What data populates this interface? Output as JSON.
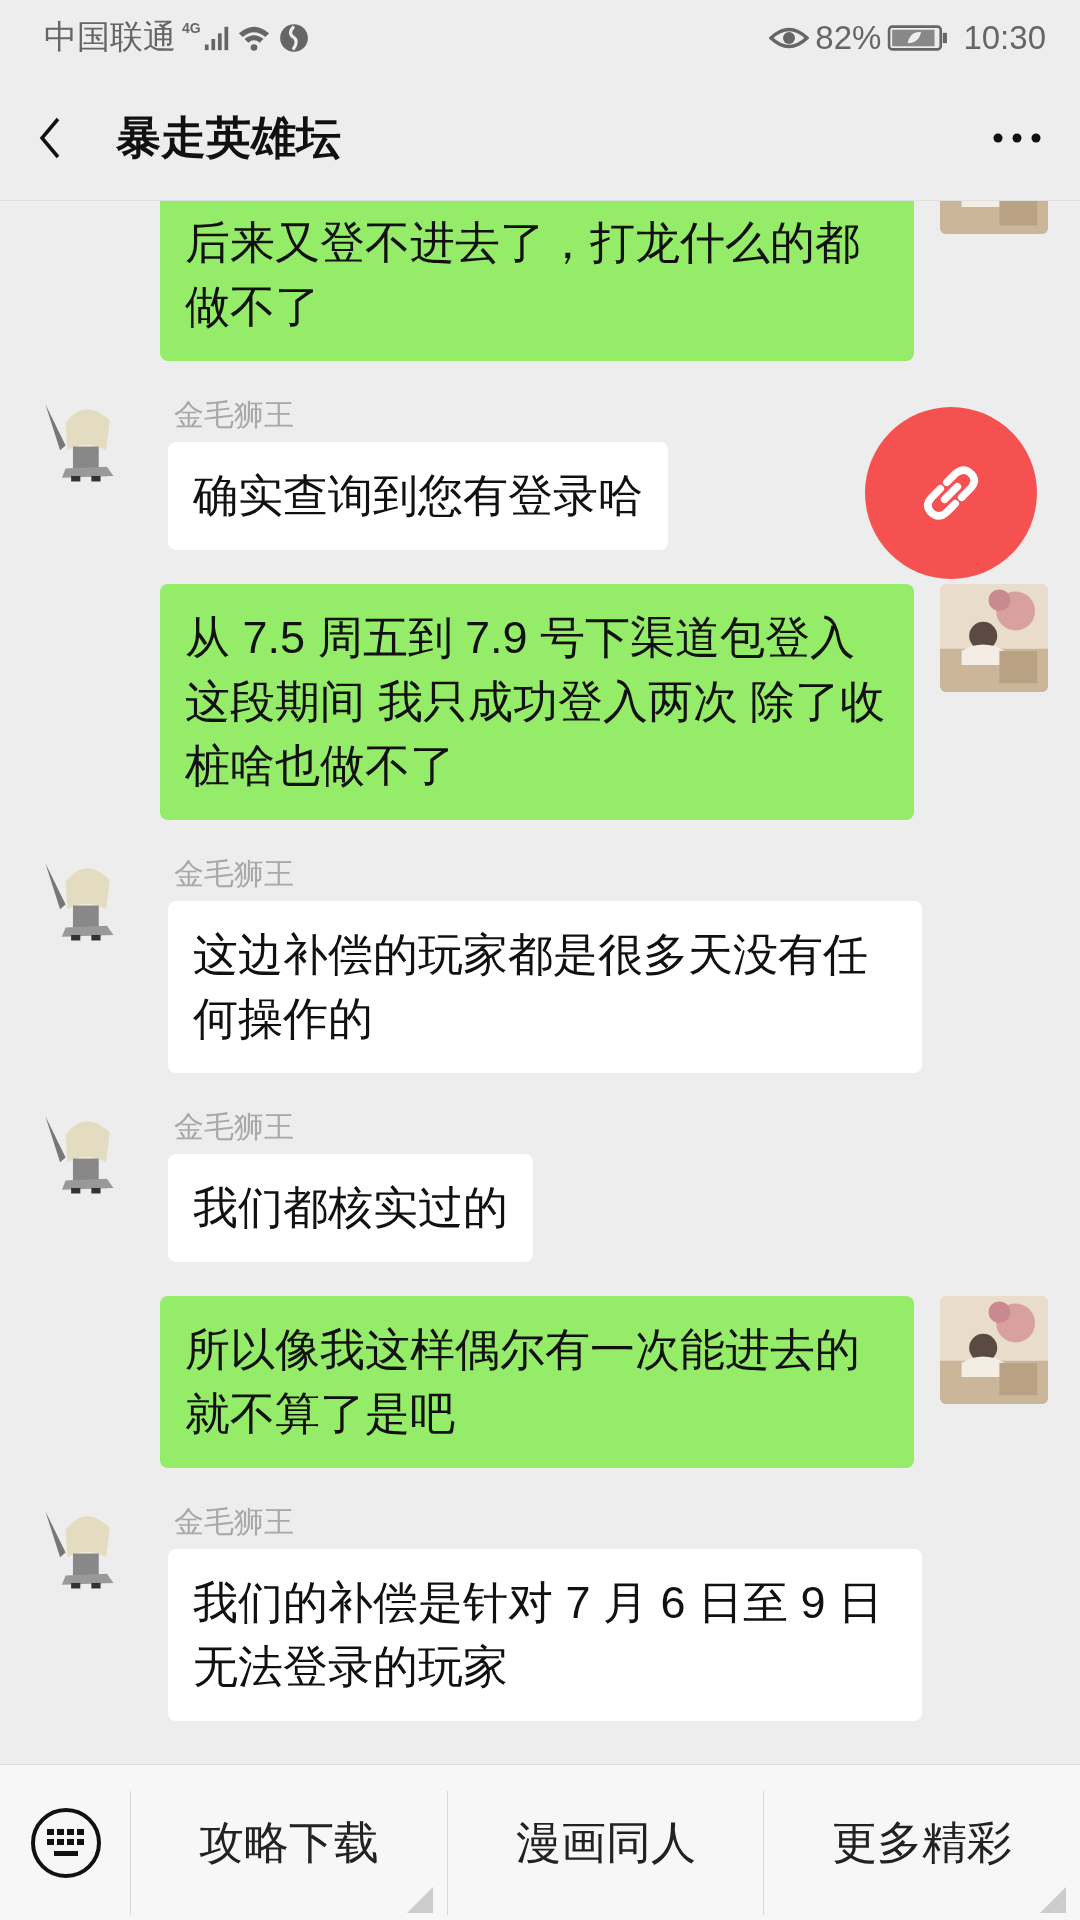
{
  "status_bar": {
    "carrier": "中国联通",
    "network": "4G",
    "battery": "82%",
    "time": "10:30"
  },
  "header": {
    "title": "暴走英雄坛"
  },
  "messages": [
    {
      "kind": "sent",
      "text": "后来又登不进去了，打龙什么的都做不了",
      "cut_top": true
    },
    {
      "kind": "received",
      "sender": "金毛狮王",
      "text": "确实查询到您有登录哈"
    },
    {
      "kind": "sent",
      "text": "从 7.5 周五到 7.9 号下渠道包登入这段期间 我只成功登入两次 除了收桩啥也做不了"
    },
    {
      "kind": "received",
      "sender": "金毛狮王",
      "text": "这边补偿的玩家都是很多天没有任何操作的"
    },
    {
      "kind": "received",
      "sender": "金毛狮王",
      "text": "我们都核实过的"
    },
    {
      "kind": "sent",
      "text": "所以像我这样偶尔有一次能进去的就不算了是吧"
    },
    {
      "kind": "received",
      "sender": "金毛狮王",
      "text": "我们的补偿是针对 7 月 6 日至 9 日无法登录的玩家"
    }
  ],
  "menu": [
    {
      "label": "攻略下载",
      "has_submenu": true
    },
    {
      "label": "漫画同人",
      "has_submenu": false
    },
    {
      "label": "更多精彩",
      "has_submenu": true
    }
  ]
}
